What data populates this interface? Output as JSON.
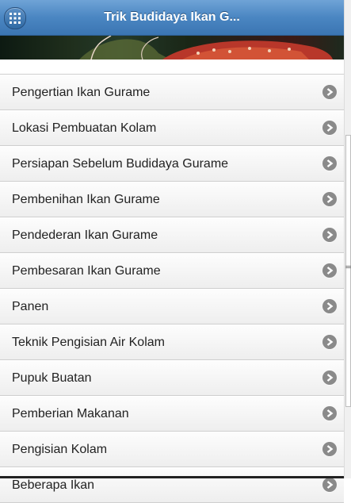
{
  "header": {
    "title": "Trik Budidaya Ikan G...",
    "menu_icon": "grid-menu-icon"
  },
  "banner": {
    "image_name": "fish-banner-image"
  },
  "menu": {
    "items": [
      {
        "label": "Pengertian Ikan Gurame"
      },
      {
        "label": "Lokasi Pembuatan Kolam"
      },
      {
        "label": "Persiapan Sebelum Budidaya Gurame"
      },
      {
        "label": "Pembenihan Ikan Gurame"
      },
      {
        "label": "Pendederan Ikan Gurame"
      },
      {
        "label": "Pembesaran Ikan Gurame"
      },
      {
        "label": "Panen"
      },
      {
        "label": "Teknik Pengisian Air Kolam"
      },
      {
        "label": "Pupuk Buatan"
      },
      {
        "label": "Pemberian Makanan"
      },
      {
        "label": "Pengisian Kolam"
      },
      {
        "label": "Beberapa Ikan"
      }
    ],
    "arrow_icon": "chevron-right-icon"
  },
  "colors": {
    "header_accent": "#4a86c2",
    "arrow": "#8a8a8a"
  }
}
